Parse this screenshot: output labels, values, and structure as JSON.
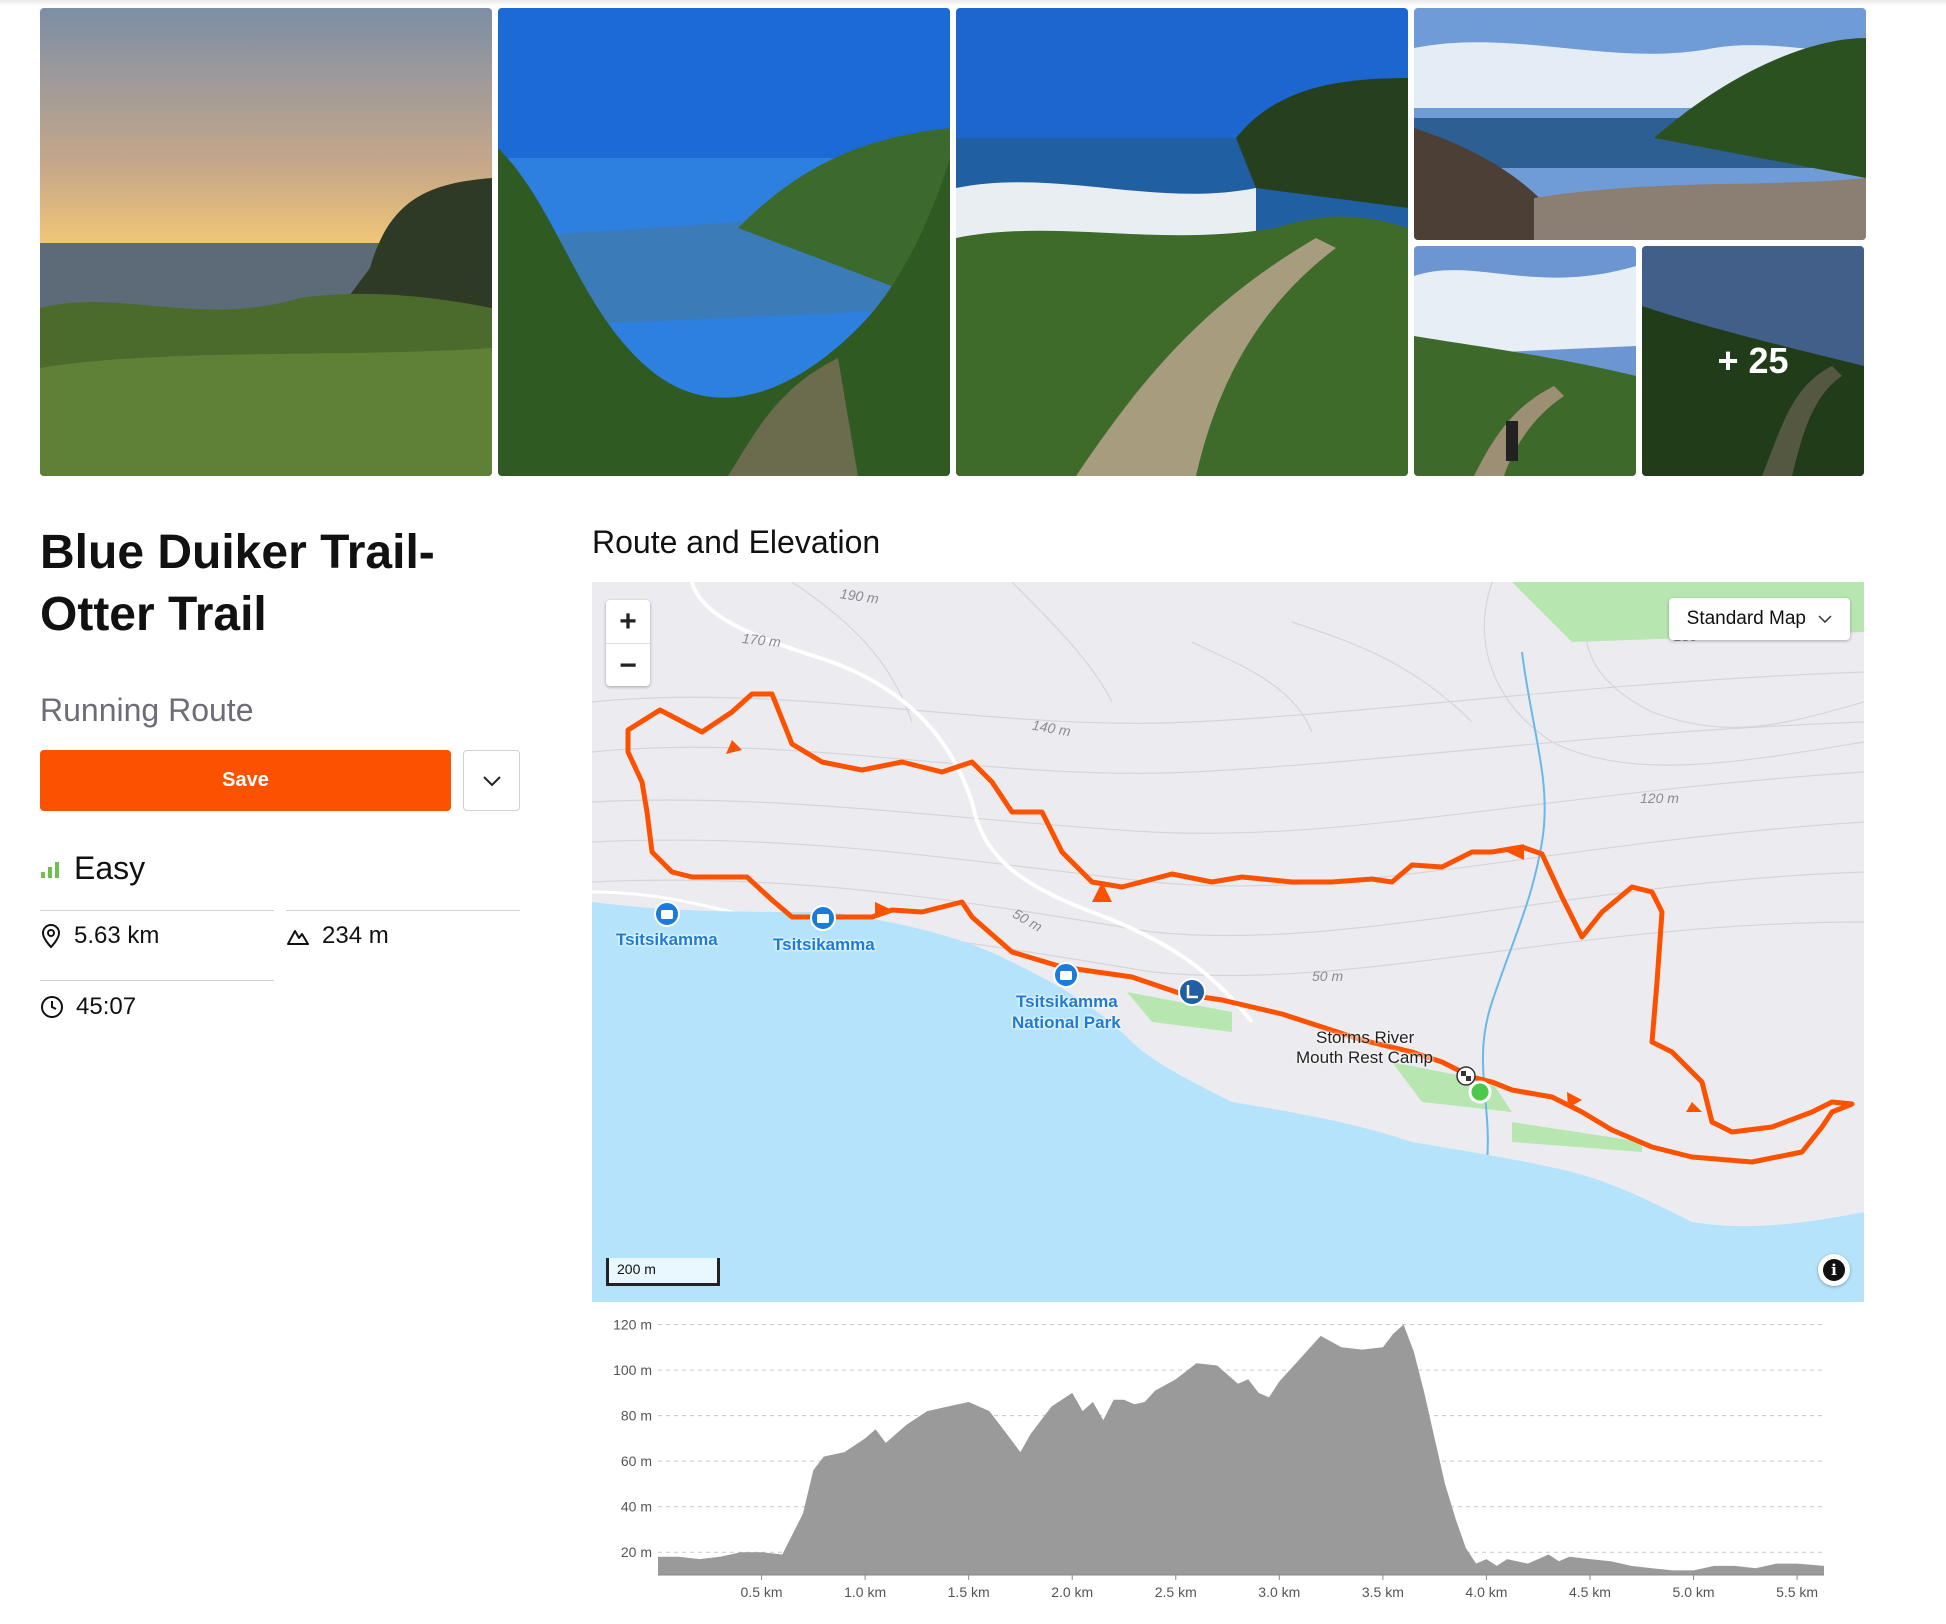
{
  "gallery": {
    "more_count_label": "+ 25"
  },
  "route": {
    "title": "Blue Duiker Trail-Otter Trail",
    "type_label": "Running Route",
    "save_label": "Save",
    "difficulty": "Easy",
    "distance": "5.63 km",
    "elevation_gain": "234 m",
    "time": "45:07"
  },
  "map_section": {
    "title": "Route and Elevation",
    "map_type": "Standard Map",
    "scale_label": "200 m",
    "zoom_in": "+",
    "zoom_out": "−",
    "info": "i",
    "places": {
      "p1": "Tsitsikamma",
      "p2": "Tsitsikamma",
      "p3_line1": "Tsitsikamma",
      "p3_line2": "National Park",
      "camp_line1": "Storms River",
      "camp_line2": "Mouth Rest Camp"
    },
    "contours": [
      "190 m",
      "170 m",
      "140 m",
      "120 m",
      "50 m",
      "50 m",
      "180"
    ]
  },
  "colors": {
    "accent": "#fc5200",
    "water": "#b4e3fb",
    "park": "#b8e6b0",
    "poi": "#1a7bd9",
    "elevation_fill": "#9a9a9a"
  },
  "chart_data": {
    "type": "area",
    "xlabel": "",
    "ylabel": "",
    "x_ticks": [
      "0.5 km",
      "1.0 km",
      "1.5 km",
      "2.0 km",
      "2.5 km",
      "3.0 km",
      "3.5 km",
      "4.0 km",
      "4.5 km",
      "5.0 km",
      "5.5 km"
    ],
    "y_ticks": [
      "20 m",
      "40 m",
      "60 m",
      "80 m",
      "100 m",
      "120 m"
    ],
    "xlim": [
      0,
      5.63
    ],
    "ylim": [
      10,
      122
    ],
    "x": [
      0,
      0.1,
      0.2,
      0.3,
      0.4,
      0.5,
      0.6,
      0.7,
      0.75,
      0.8,
      0.9,
      1.0,
      1.05,
      1.1,
      1.15,
      1.2,
      1.25,
      1.3,
      1.4,
      1.5,
      1.6,
      1.7,
      1.75,
      1.8,
      1.9,
      2.0,
      2.05,
      2.1,
      2.15,
      2.2,
      2.25,
      2.3,
      2.35,
      2.4,
      2.5,
      2.6,
      2.7,
      2.75,
      2.8,
      2.85,
      2.9,
      2.95,
      3.0,
      3.1,
      3.2,
      3.3,
      3.4,
      3.5,
      3.55,
      3.6,
      3.65,
      3.7,
      3.75,
      3.8,
      3.85,
      3.9,
      3.95,
      4.0,
      4.05,
      4.1,
      4.2,
      4.3,
      4.35,
      4.4,
      4.5,
      4.6,
      4.7,
      4.8,
      4.9,
      5.0,
      5.1,
      5.2,
      5.3,
      5.4,
      5.5,
      5.63
    ],
    "values": [
      18,
      18,
      17,
      18,
      20,
      20,
      19,
      37,
      56,
      62,
      64,
      70,
      74,
      68,
      72,
      76,
      79,
      82,
      84,
      86,
      82,
      70,
      64,
      72,
      84,
      90,
      82,
      86,
      78,
      87,
      87,
      85,
      86,
      91,
      96,
      103,
      102,
      98,
      94,
      96,
      90,
      88,
      95,
      105,
      115,
      110,
      109,
      110,
      116,
      120,
      108,
      90,
      70,
      50,
      35,
      22,
      15,
      17,
      14,
      17,
      15,
      19,
      16,
      18,
      17,
      16,
      14,
      13,
      12,
      12,
      14,
      14,
      13,
      15,
      15,
      14
    ]
  }
}
